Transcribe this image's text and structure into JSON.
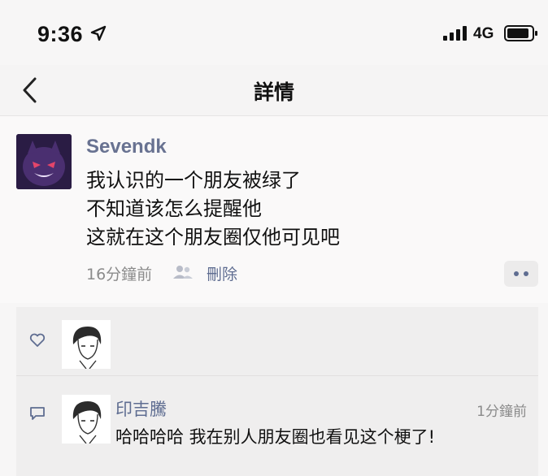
{
  "status_bar": {
    "time": "9:36",
    "network": "4G",
    "icons": [
      "location-arrow-icon",
      "signal-icon",
      "battery-icon"
    ]
  },
  "nav": {
    "title": "詳情",
    "back_icon": "chevron-left-icon"
  },
  "post": {
    "username": "Sevendk",
    "lines": [
      "我认识的一个朋友被绿了",
      "不知道该怎么提醒他",
      "这就在这个朋友圈仅他可见吧"
    ],
    "time": "16分鐘前",
    "privacy_icon": "people-icon",
    "delete_label": "刪除",
    "more_icon": "more-dots-icon"
  },
  "interactions": {
    "like_icon": "heart-icon",
    "comment_icon": "comment-bubble-icon",
    "comment": {
      "name": "印吉騰",
      "time": "1分鐘前",
      "text": "哈哈哈哈 我在别人朋友圈也看见这个梗了!"
    }
  },
  "colors": {
    "name_blue": "#5f6d91",
    "muted_gray": "#8b8b8b",
    "background": "#f7f6f6",
    "panel": "#efeeee"
  }
}
